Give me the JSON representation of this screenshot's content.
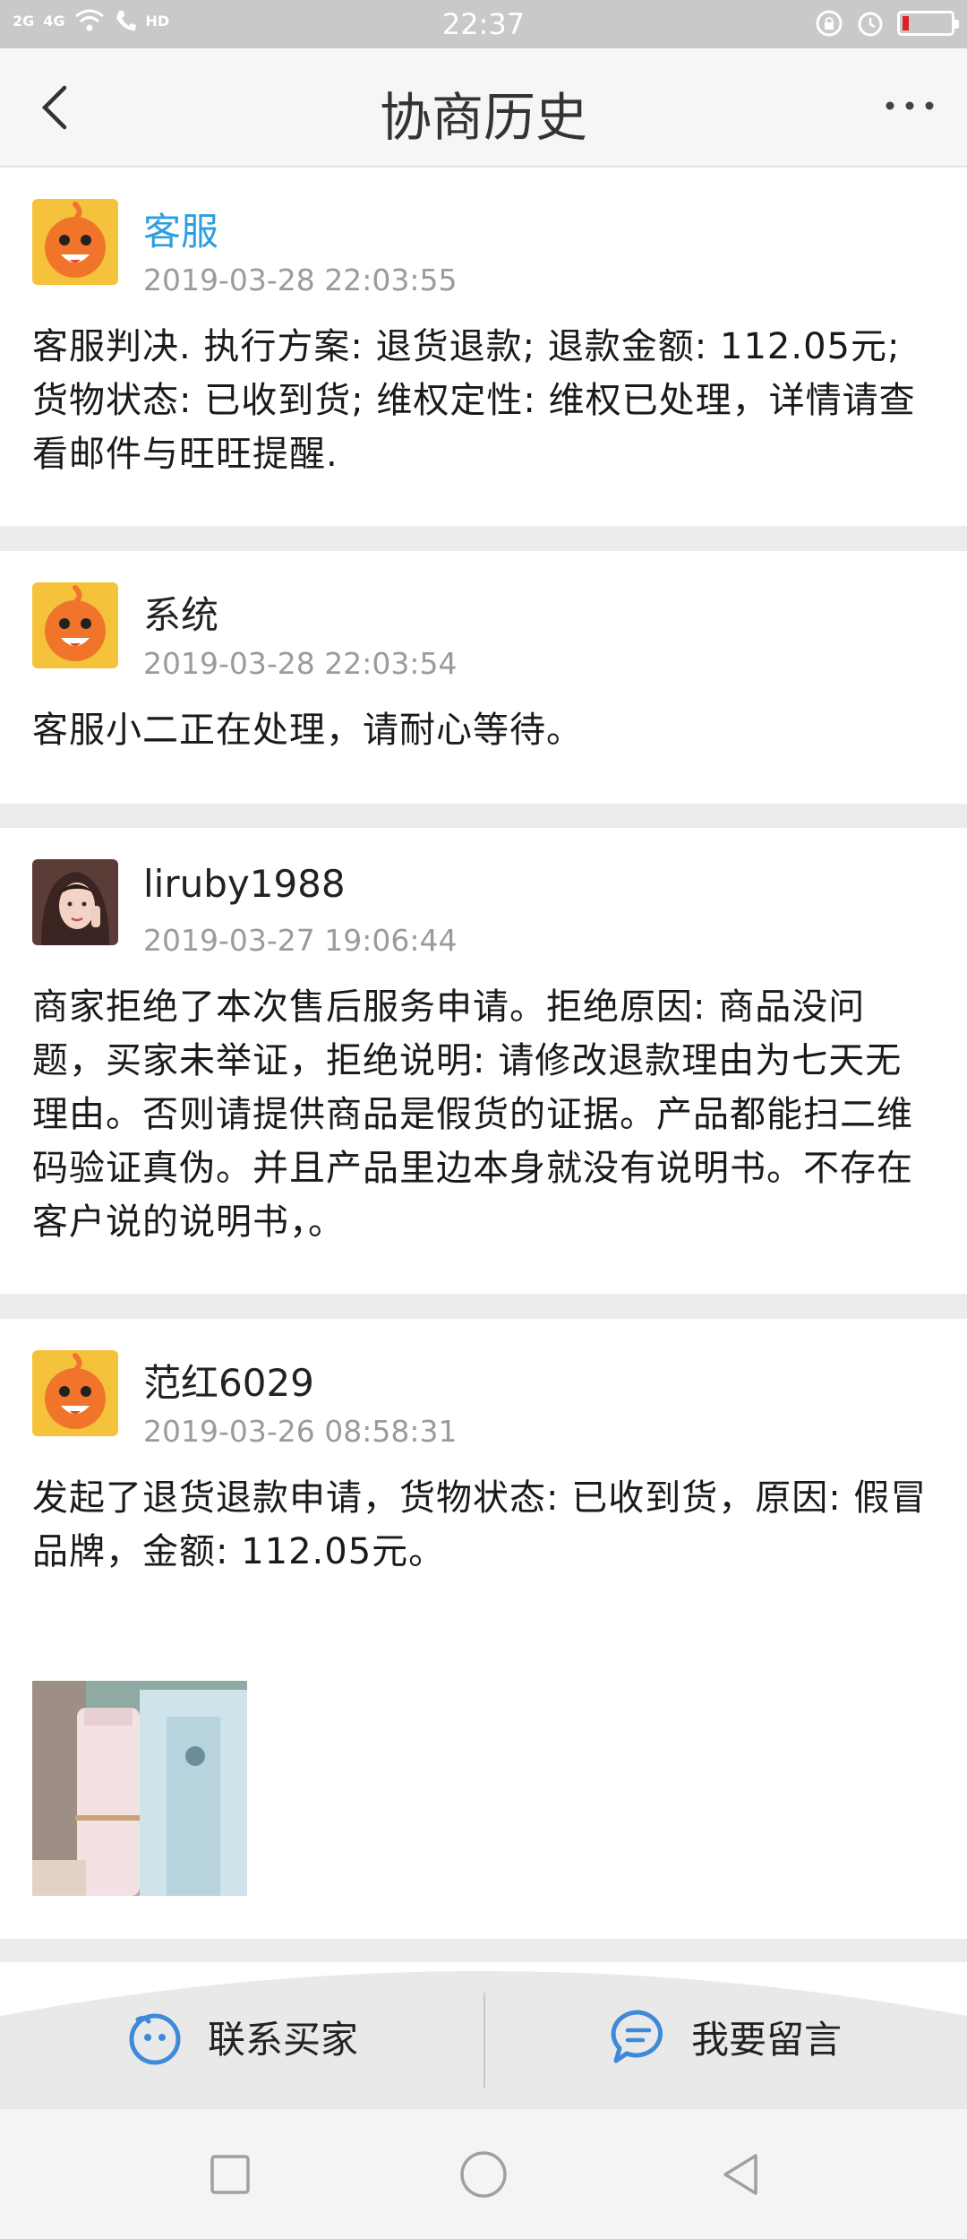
{
  "status_bar": {
    "signal_1": "2G",
    "signal_2": "4G",
    "hd": "HD",
    "time": "22:37"
  },
  "nav": {
    "title": "协商历史"
  },
  "entries": [
    {
      "name": "客服",
      "time": "2019-03-28 22:03:55",
      "message": "客服判决. 执行方案: 退货退款; 退款金额: 112.05元; 货物状态: 已收到货; 维权定性: 维权已处理，详情请查看邮件与旺旺提醒."
    },
    {
      "name": "系统",
      "time": "2019-03-28 22:03:54",
      "message": "客服小二正在处理，请耐心等待。"
    },
    {
      "name": "liruby1988",
      "time": "2019-03-27 19:06:44",
      "message": "商家拒绝了本次售后服务申请。拒绝原因: 商品没问题，买家未举证，拒绝说明: 请修改退款理由为七天无理由。否则请提供商品是假货的证据。产品都能扫二维码验证真伪。并且产品里边本身就没有说明书。不存在客户说的说明书，。"
    },
    {
      "name": "范红6029",
      "time": "2019-03-26 08:58:31",
      "message": "发起了退货退款申请，货物状态: 已收到货，原因: 假冒品牌，金额: 112.05元。"
    }
  ],
  "actions": {
    "contact_buyer": "联系买家",
    "leave_message": "我要留言"
  },
  "colors": {
    "name_highlight": "#2c9fe0",
    "time_gray": "#9b9b9b",
    "avatar_orange": "#f0752a"
  }
}
